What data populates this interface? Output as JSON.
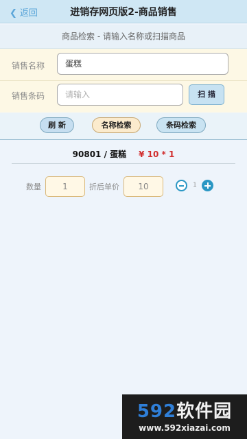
{
  "header": {
    "back_label": "返回",
    "title": "进销存网页版2-商品销售"
  },
  "hint": "商品检索 - 请输入名称或扫描商品",
  "form": {
    "name_label": "销售名称",
    "name_value": "蛋糕",
    "barcode_label": "销售条码",
    "barcode_placeholder": "请输入",
    "scan_label": "扫 描"
  },
  "actions": {
    "refresh": "刷 新",
    "name_search": "名称检索",
    "barcode_search": "条码检索"
  },
  "item": {
    "code_name": "90801 / 蛋糕",
    "price": "¥ 10 * 1"
  },
  "qty": {
    "qty_label": "数量",
    "qty_value": "1",
    "unit_price_label": "折后单价",
    "unit_price_value": "10",
    "count": "1"
  },
  "watermark": {
    "logo_num": "592",
    "logo_cn": "软件园",
    "url": "www.592xiazai.com"
  },
  "colors": {
    "accent": "#2a97c4",
    "price": "#d12d2d",
    "nav_bg": "#cfe7f4",
    "form_bg": "#fdf8e5"
  }
}
